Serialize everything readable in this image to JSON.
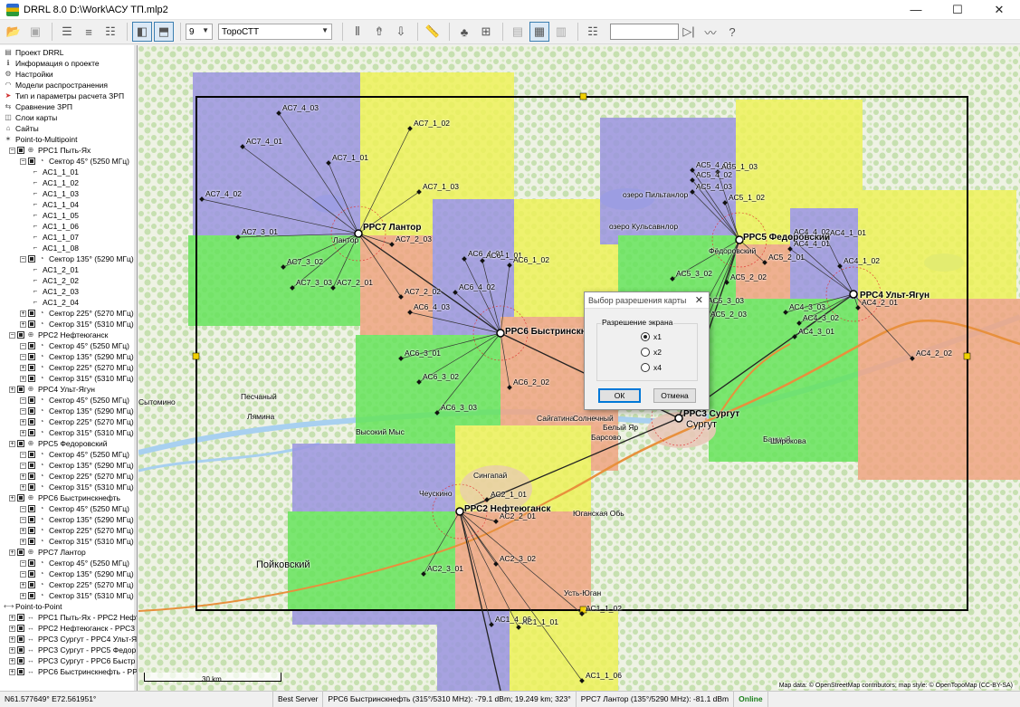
{
  "window": {
    "title": "DRRL 8.0 D:\\Work\\АСУ ТП.mlp2",
    "minimize": "—",
    "maximize": "☐",
    "close": "✕"
  },
  "toolbar": {
    "zoom_value": "9",
    "layer_value": "ТороСТТ",
    "help": "?"
  },
  "tree": {
    "items": [
      {
        "label": "Проект DRRL",
        "level": 0,
        "icon": "project-icon"
      },
      {
        "label": "Информация о проекте",
        "level": 0,
        "icon": "info-icon"
      },
      {
        "label": "Настройки",
        "level": 0,
        "icon": "gear-icon"
      },
      {
        "label": "Модели распространения",
        "level": 0,
        "icon": "propagation-icon"
      },
      {
        "label": "Тип и параметры расчета ЗРП",
        "level": 0,
        "icon": "arrow-icon"
      },
      {
        "label": "Сравнение ЗРП",
        "level": 0,
        "icon": "compare-icon"
      },
      {
        "label": "Слои карты",
        "level": 0,
        "icon": "layers-icon"
      },
      {
        "label": "Сайты",
        "level": 0,
        "icon": "sites-icon"
      },
      {
        "label": "Point-to-Multipoint",
        "level": 0,
        "icon": "p2mp-icon"
      },
      {
        "label": "РРС1 Пыть-Ях",
        "level": 1,
        "icon": "station-icon"
      },
      {
        "label": "Сектор 45° (5250 МГц)",
        "level": 2,
        "icon": "sector-icon"
      },
      {
        "label": "АС1_1_01",
        "level": 3,
        "icon": "client-icon"
      },
      {
        "label": "АС1_1_02",
        "level": 3,
        "icon": "client-icon"
      },
      {
        "label": "АС1_1_03",
        "level": 3,
        "icon": "client-icon"
      },
      {
        "label": "АС1_1_04",
        "level": 3,
        "icon": "client-icon"
      },
      {
        "label": "АС1_1_05",
        "level": 3,
        "icon": "client-icon"
      },
      {
        "label": "АС1_1_06",
        "level": 3,
        "icon": "client-icon"
      },
      {
        "label": "АС1_1_07",
        "level": 3,
        "icon": "client-icon"
      },
      {
        "label": "АС1_1_08",
        "level": 3,
        "icon": "client-icon"
      },
      {
        "label": "Сектор 135° (5290 МГц)",
        "level": 2,
        "icon": "sector-icon"
      },
      {
        "label": "АС1_2_01",
        "level": 3,
        "icon": "client-icon"
      },
      {
        "label": "АС1_2_02",
        "level": 3,
        "icon": "client-icon"
      },
      {
        "label": "АС1_2_03",
        "level": 3,
        "icon": "client-icon"
      },
      {
        "label": "АС1_2_04",
        "level": 3,
        "icon": "client-icon"
      },
      {
        "label": "Сектор 225° (5270 МГц)",
        "level": 2,
        "icon": "sector-icon"
      },
      {
        "label": "Сектор 315° (5310 МГц)",
        "level": 2,
        "icon": "sector-icon"
      },
      {
        "label": "РРС2 Нефтеюганск",
        "level": 1,
        "icon": "station-icon"
      },
      {
        "label": "Сектор 45° (5250 МГц)",
        "level": 2,
        "icon": "sector-icon"
      },
      {
        "label": "Сектор 135° (5290 МГц)",
        "level": 2,
        "icon": "sector-icon"
      },
      {
        "label": "Сектор 225° (5270 МГц)",
        "level": 2,
        "icon": "sector-icon"
      },
      {
        "label": "Сектор 315° (5310 МГц)",
        "level": 2,
        "icon": "sector-icon"
      },
      {
        "label": "РРС4 Ульт-Ягун",
        "level": 1,
        "icon": "station-icon"
      },
      {
        "label": "Сектор 45° (5250 МГц)",
        "level": 2,
        "icon": "sector-icon"
      },
      {
        "label": "Сектор 135° (5290 МГц)",
        "level": 2,
        "icon": "sector-icon"
      },
      {
        "label": "Сектор 225° (5270 МГц)",
        "level": 2,
        "icon": "sector-icon"
      },
      {
        "label": "Сектор 315° (5310 МГц)",
        "level": 2,
        "icon": "sector-icon"
      },
      {
        "label": "РРС5 Федоровский",
        "level": 1,
        "icon": "station-icon"
      },
      {
        "label": "Сектор 45° (5250 МГц)",
        "level": 2,
        "icon": "sector-icon"
      },
      {
        "label": "Сектор 135° (5290 МГц)",
        "level": 2,
        "icon": "sector-icon"
      },
      {
        "label": "Сектор 225° (5270 МГц)",
        "level": 2,
        "icon": "sector-icon"
      },
      {
        "label": "Сектор 315° (5310 МГц)",
        "level": 2,
        "icon": "sector-icon"
      },
      {
        "label": "РРС6 Быстринскнефть",
        "level": 1,
        "icon": "station-icon"
      },
      {
        "label": "Сектор 45° (5250 МГц)",
        "level": 2,
        "icon": "sector-icon"
      },
      {
        "label": "Сектор 135° (5290 МГц)",
        "level": 2,
        "icon": "sector-icon"
      },
      {
        "label": "Сектор 225° (5270 МГц)",
        "level": 2,
        "icon": "sector-icon"
      },
      {
        "label": "Сектор 315° (5310 МГц)",
        "level": 2,
        "icon": "sector-icon"
      },
      {
        "label": "РРС7 Лантор",
        "level": 1,
        "icon": "station-icon"
      },
      {
        "label": "Сектор 45° (5250 МГц)",
        "level": 2,
        "icon": "sector-icon"
      },
      {
        "label": "Сектор 135° (5290 МГц)",
        "level": 2,
        "icon": "sector-icon"
      },
      {
        "label": "Сектор 225° (5270 МГц)",
        "level": 2,
        "icon": "sector-icon"
      },
      {
        "label": "Сектор 315° (5310 МГц)",
        "level": 2,
        "icon": "sector-icon"
      },
      {
        "label": "Point-to-Point",
        "level": 0,
        "icon": "p2p-icon"
      },
      {
        "label": "РРС1 Пыть-Ях - РРС2 Нефт",
        "level": 1,
        "icon": "link-icon"
      },
      {
        "label": "РРС2 Нефтеюганск - РРС3",
        "level": 1,
        "icon": "link-icon"
      },
      {
        "label": "РРС3 Сургут - РРС4 Ульт-Я",
        "level": 1,
        "icon": "link-icon"
      },
      {
        "label": "РРС3 Сургут - РРС5 Федор",
        "level": 1,
        "icon": "link-icon"
      },
      {
        "label": "РРС3 Сургут - РРС6 Быстр",
        "level": 1,
        "icon": "link-icon"
      },
      {
        "label": "РРС6 Быстринскнефть - РР",
        "level": 1,
        "icon": "link-icon"
      }
    ]
  },
  "map": {
    "stations": [
      {
        "label": "РРС7 Лантор"
      },
      {
        "label": "РРС6 Быстринскне"
      },
      {
        "label": "РРС5 Федоровский"
      },
      {
        "label": "РРС4 Ульт-Ягун"
      },
      {
        "label": "РРС3 Сургут"
      },
      {
        "label": "РРС2 Нефтеюганск"
      }
    ],
    "clients": [
      "АС7_4_03",
      "АС7_4_01",
      "АС7_4_02",
      "АС7_3_01",
      "АС7_3_02",
      "АС7_3_03",
      "АС7_2_01",
      "АС7_2_02",
      "АС7_2_03",
      "АС7_1_01",
      "АС7_1_02",
      "АС7_1_03",
      "АС6_4_01",
      "АС6_4_02",
      "АС6_4_03",
      "АС6_1_01",
      "АС6_1_02",
      "АС6_3_01",
      "АС6_3_02",
      "АС6_3_03",
      "АС6_2_02",
      "АС5_4_01",
      "АС5_4_02",
      "АС5_4_03",
      "АС5_1_03",
      "АС5_1_02",
      "АС5_3_02",
      "АС5_3_03",
      "АС5_2_01",
      "АС5_2_02",
      "АС5_2_03",
      "АС4_4_01",
      "АС4_4_02",
      "АС4_1_01",
      "АС4_1_02",
      "АС4_2_01",
      "АС4_2_02",
      "АС4_3_01",
      "АС4_3_02",
      "АС4_3_03",
      "АС2_1_01",
      "АС2_2_01",
      "АС2_3_01",
      "АС2_3_02",
      "АС1_1_01",
      "АС1_1_02",
      "АС1_1_06",
      "АС1_4_06"
    ],
    "places": [
      "Песчаный",
      "Лямина",
      "Сытомино",
      "Высокий Мыс",
      "Сайгатина",
      "Солнечный",
      "Белый Яр",
      "Барсово",
      "Сургут",
      "Банный",
      "Широкова",
      "Сингапай",
      "Чеускино",
      "Юганская Обь",
      "Пойковский",
      "Усть-Юган",
      "Лантор",
      "озеро Пильтанлор",
      "озеро Кульсавнлор",
      "Фёдоровский"
    ],
    "scale": "30 km",
    "attribution": "Map data: © OpenStreetMap contributors; map style: © OpenTopoMap (CC-BY-SA)"
  },
  "dialog": {
    "title": "Выбор разрешения карты",
    "group_label": "Разрешение экрана",
    "options": [
      "x1",
      "x2",
      "x4"
    ],
    "selected": "x1",
    "ok": "ОК",
    "cancel": "Отмена"
  },
  "status": {
    "coords": "N61.577649°  E72.561951°",
    "mode": "Best Server",
    "signal1": "РРС6 Быстринскнефть (315°/5310 MHz): -79.1 dBm; 19.249 km; 323°",
    "signal2": "РРС7 Лантор (135°/5290 MHz): -81.1 dBm",
    "online": "Online"
  },
  "colors": {
    "coverage_purple": "#9b95e0",
    "coverage_yellow": "#eef25a",
    "coverage_green": "#66e45c",
    "coverage_salmon": "#f0a582",
    "map_bg": "#eef2e4",
    "forest": "#c6e0b0",
    "water": "#a8d0f0",
    "road_orange": "#e8903c"
  }
}
